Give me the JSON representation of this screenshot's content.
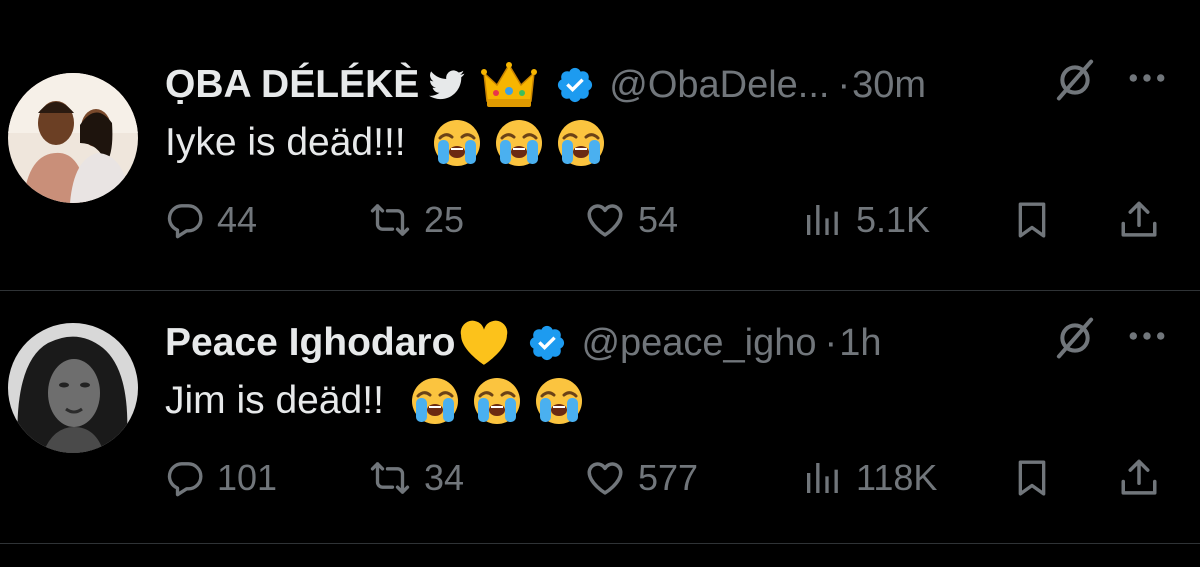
{
  "tweets": [
    {
      "display_name": "ỌBA DÉLÉKÈ",
      "handle": "@ObaDele...",
      "time": "30m",
      "text": "Iyke is deäd!!!",
      "badges": [
        "twitter-bird-icon",
        "crown-emoji",
        "verified-badge-icon"
      ],
      "reply_count": "44",
      "retweet_count": "25",
      "like_count": "54",
      "view_count": "5.1K"
    },
    {
      "display_name": "Peace Ighodaro",
      "handle": "@peace_igho",
      "time": "1h",
      "text": "Jim is deäd!!",
      "badges": [
        "yellow-heart-emoji",
        "verified-badge-icon"
      ],
      "reply_count": "101",
      "retweet_count": "34",
      "like_count": "577",
      "view_count": "118K"
    }
  ],
  "separator": "·",
  "colors": {
    "background": "#000000",
    "text": "#e7e9ea",
    "secondary": "#71767b",
    "verified": "#1d9bf0",
    "divider": "#2f3336"
  }
}
